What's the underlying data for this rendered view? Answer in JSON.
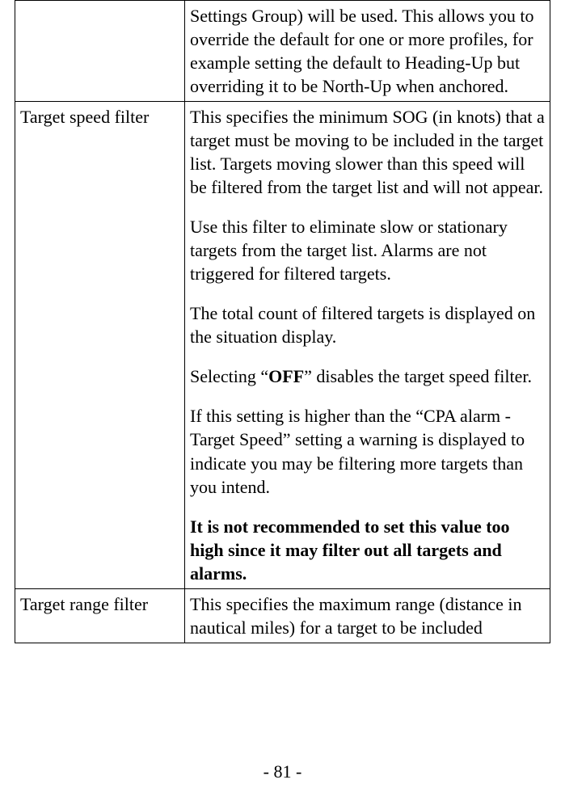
{
  "rows": {
    "r0": {
      "label": "",
      "desc1": "Settings Group) will be used. This allows you to override the default for one or more profiles, for example setting the default to Heading-Up but overriding it to be North-Up when anchored."
    },
    "r1": {
      "label": "Target speed filter",
      "desc1": "This specifies the minimum SOG (in knots) that a target must be moving to be included in the target list. Targets moving slower than this speed will be filtered from the target list and will not appear.",
      "desc2": "Use this filter to eliminate slow or stationary targets from the target list. Alarms are not triggered for filtered targets.",
      "desc3": "The total count of filtered targets is displayed on the situation display.",
      "desc4a": "Selecting “",
      "desc4b": "OFF",
      "desc4c": "” disables the target speed filter.",
      "desc5": "If this setting is higher than the “CPA alarm - Target Speed” setting a warning is displayed to indicate you may be filtering more targets than you intend.",
      "desc6": "It is not recommended to set this value too high since it may filter out all targets and alarms."
    },
    "r2": {
      "label": "Target range filter",
      "desc1": "This specifies the maximum range (distance in nautical miles) for a target to be included"
    }
  },
  "page_number": "- 81 -"
}
